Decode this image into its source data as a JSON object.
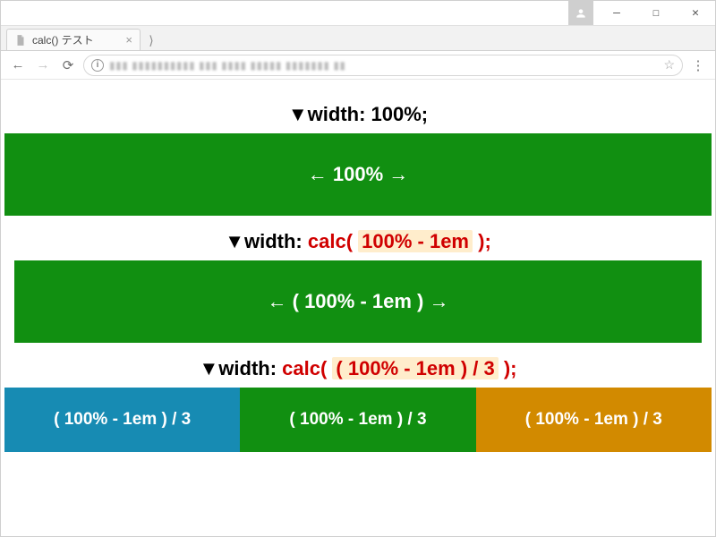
{
  "window": {
    "tab_title": "calc() テスト",
    "url_display": "▮▮▮ ▮▮▮▮▮▮▮▮▮▮ ▮▮▮ ▮▮▮▮ ▮▮▮▮▮ ▮▮▮▮▮▮▮ ▮▮"
  },
  "sections": {
    "s1": {
      "marker": "▼",
      "prop": "width: ",
      "value_plain": "100%;",
      "box_label": "← 100% →"
    },
    "s2": {
      "marker": "▼",
      "prop": "width: ",
      "fn_open": "calc( ",
      "hl": "100% - 1em",
      "fn_close": " );",
      "box_label": "← ( 100% - 1em ) →"
    },
    "s3": {
      "marker": "▼",
      "prop": "width: ",
      "fn_open": "calc( ",
      "hl": "( 100% - 1em ) / 3",
      "fn_close": " );",
      "box_a": "( 100% - 1em ) / 3",
      "box_b": "( 100% - 1em ) / 3",
      "box_c": "( 100% - 1em ) / 3"
    }
  },
  "colors": {
    "green": "#118f11",
    "blue": "#178bb3",
    "orange": "#d28a00",
    "calc_red": "#d00000",
    "highlight_bg": "#ffedcc"
  }
}
